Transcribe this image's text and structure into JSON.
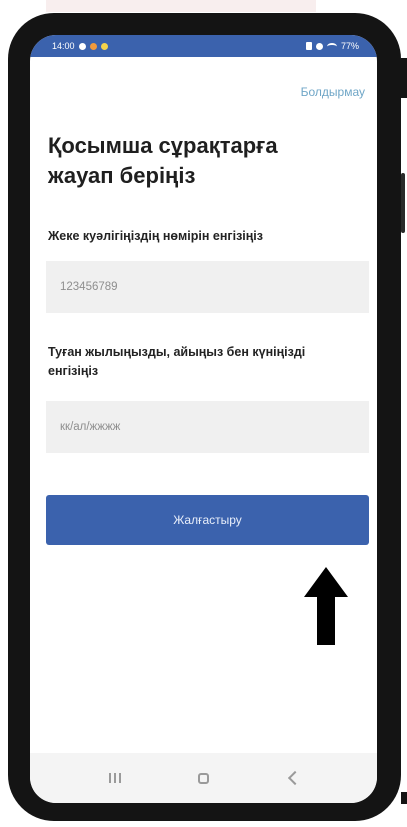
{
  "status_bar": {
    "time": "14:00",
    "battery": "77%"
  },
  "header": {
    "cancel_label": "Болдырмау"
  },
  "form": {
    "title": "Қосымша сұрақтарға жауап беріңіз",
    "id_label": "Жеке куәлігіңіздің нөмірін енгізіңіз",
    "id_value": "123456789",
    "dob_label": "Туған жылыңызды, айыңыз бен күніңізді енгізіңіз",
    "dob_placeholder": "кк/ал/жжжж"
  },
  "actions": {
    "continue_label": "Жалғастыру"
  },
  "icons": {
    "annotation": "arrow-up-icon",
    "nav_recents": "recents-icon",
    "nav_home": "home-icon",
    "nav_back": "back-icon"
  },
  "colors": {
    "primary": "#3b62ad",
    "link": "#6fa6c7",
    "field_bg": "#f0f0f0",
    "frame": "#141414"
  }
}
